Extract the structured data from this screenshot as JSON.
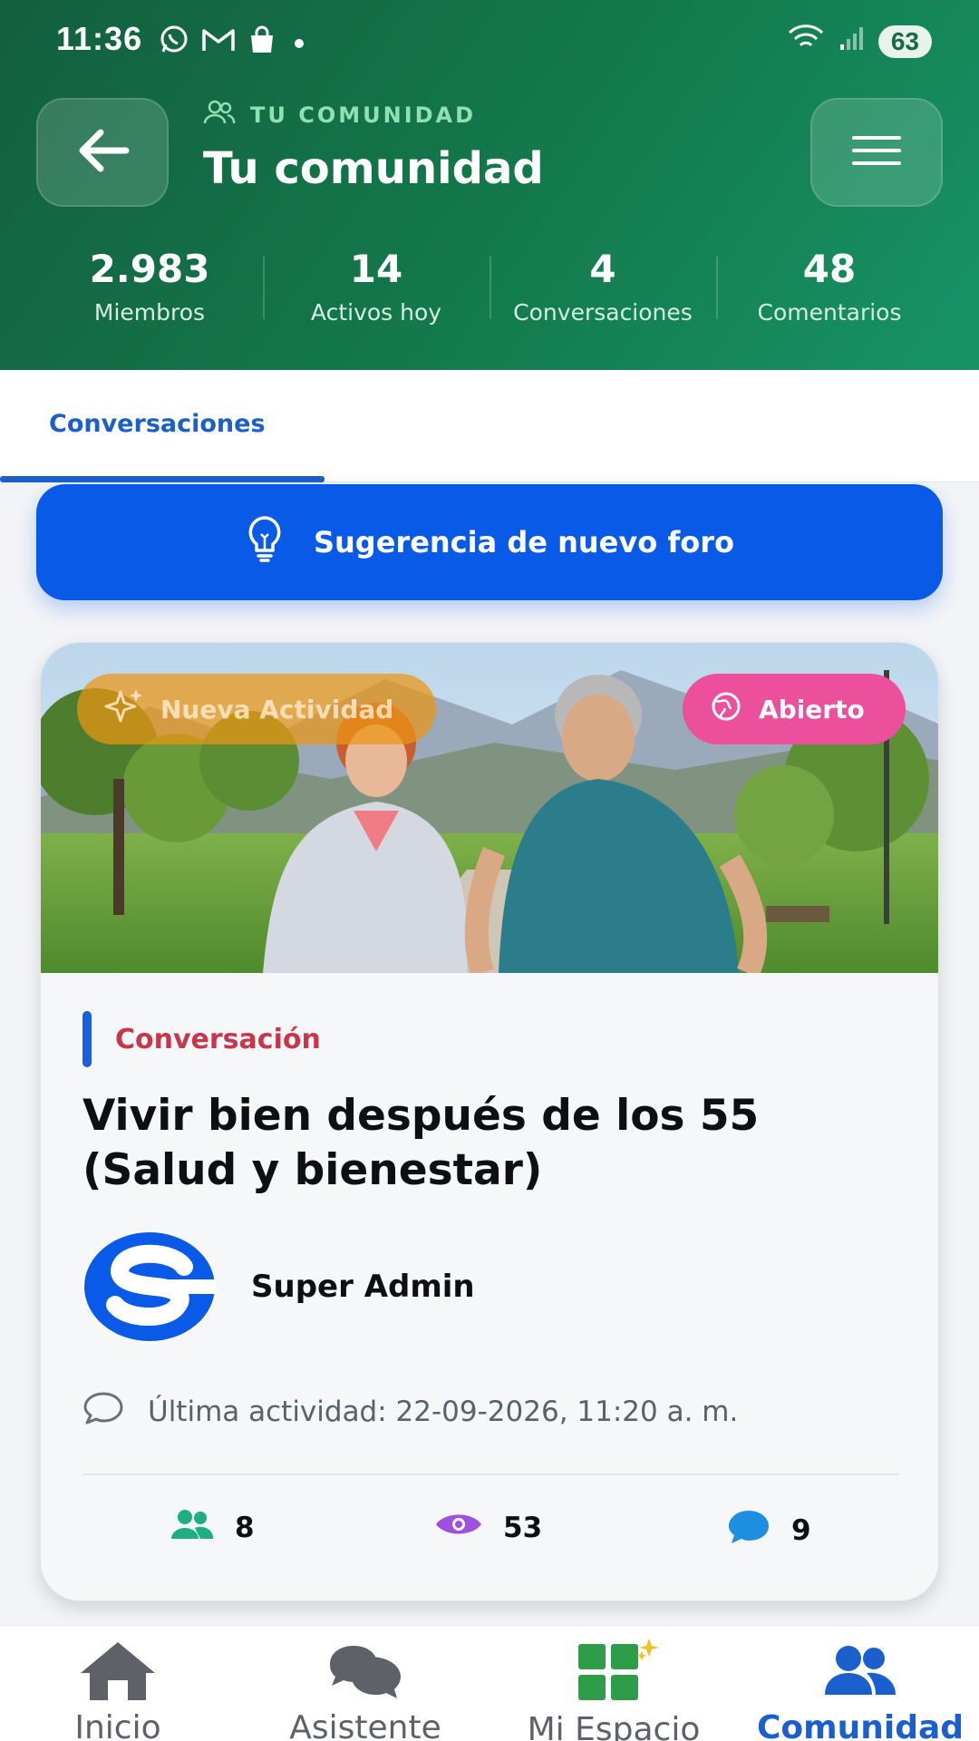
{
  "status_bar": {
    "time": "11:36",
    "battery": "63",
    "left_icons": [
      "whatsapp-icon",
      "gmail-icon",
      "shopping-bag-icon",
      "dot-icon"
    ],
    "right_icons": [
      "wifi-icon",
      "signal-icon",
      "battery-icon"
    ]
  },
  "header": {
    "eyebrow": "TU COMUNIDAD",
    "title": "Tu comunidad",
    "stats": [
      {
        "value": "2.983",
        "label": "Miembros"
      },
      {
        "value": "14",
        "label": "Activos hoy"
      },
      {
        "value": "4",
        "label": "Conversaciones"
      },
      {
        "value": "48",
        "label": "Comentarios"
      }
    ]
  },
  "tabs": [
    {
      "label": "Conversaciones",
      "active": true
    }
  ],
  "suggest_button": {
    "label": "Sugerencia de nuevo foro",
    "icon": "lightbulb-icon"
  },
  "card": {
    "badge_new": "Nueva Actividad",
    "badge_status": "Abierto",
    "category": "Conversación",
    "title": "Vivir bien después de los 55 (Salud y bienestar)",
    "author": "Super Admin",
    "last_activity": "Última actividad: 22-09-2026, 11:20 a. m.",
    "metrics": {
      "participants": "8",
      "views": "53",
      "comments": "9"
    }
  },
  "bottom_nav": [
    {
      "label": "Inicio",
      "icon": "home-icon",
      "active": false
    },
    {
      "label": "Asistente",
      "icon": "chat-bubbles-icon",
      "active": false
    },
    {
      "label": "Mi Espacio",
      "icon": "grid-icon",
      "active": false
    },
    {
      "label": "Comunidad",
      "icon": "people-icon",
      "active": true
    }
  ],
  "colors": {
    "header_green": "#137a4c",
    "accent_blue": "#1a5fcc",
    "button_blue": "#0a5ae8",
    "badge_pink": "#ec4f9c",
    "badge_orange": "#ec9614",
    "category_red": "#c7364a"
  }
}
